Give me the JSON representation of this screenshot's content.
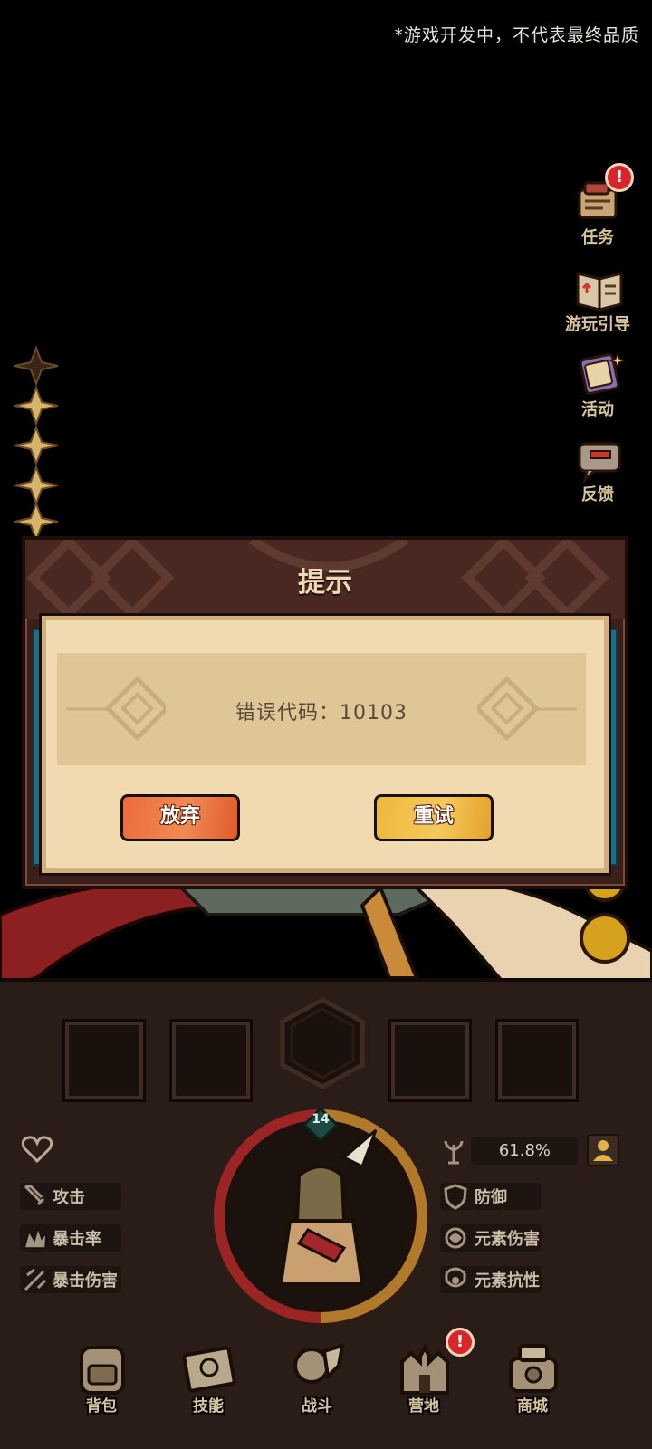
{
  "disclaimer": "*游戏开发中，不代表最终品质",
  "side_menu": [
    {
      "label": "任务",
      "icon": "scroll-quest-icon",
      "badge": "!"
    },
    {
      "label": "游玩引导",
      "icon": "guide-book-icon"
    },
    {
      "label": "活动",
      "icon": "event-map-icon"
    },
    {
      "label": "反馈",
      "icon": "feedback-chat-icon"
    }
  ],
  "stars": {
    "filled": 4,
    "total": 5
  },
  "dialog": {
    "title": "提示",
    "message": "错误代码：10103",
    "buttons": {
      "abandon": "放弃",
      "retry": "重试"
    }
  },
  "hero": {
    "level": "14",
    "resource_percent": "61.8%"
  },
  "stats_left": [
    {
      "label": "攻击",
      "icon": "sword-icon"
    },
    {
      "label": "暴击率",
      "icon": "crit-rate-icon"
    },
    {
      "label": "暴击伤害",
      "icon": "crit-damage-icon"
    }
  ],
  "stats_right": [
    {
      "label": "防御",
      "icon": "shield-icon"
    },
    {
      "label": "元素伤害",
      "icon": "element-damage-icon"
    },
    {
      "label": "元素抗性",
      "icon": "element-resist-icon"
    }
  ],
  "bottom_nav": [
    {
      "label": "背包",
      "icon": "backpack-icon"
    },
    {
      "label": "技能",
      "icon": "skill-book-icon"
    },
    {
      "label": "战斗",
      "icon": "battle-icon"
    },
    {
      "label": "营地",
      "icon": "camp-castle-icon",
      "badge": "!"
    },
    {
      "label": "商城",
      "icon": "shop-icon"
    }
  ],
  "colors": {
    "dialog_frame": "#3b1f1a",
    "dialog_body": "#f2dab0",
    "abandon_button": "#ec6c3c",
    "retry_button": "#efb73c",
    "badge": "#d8252c"
  }
}
